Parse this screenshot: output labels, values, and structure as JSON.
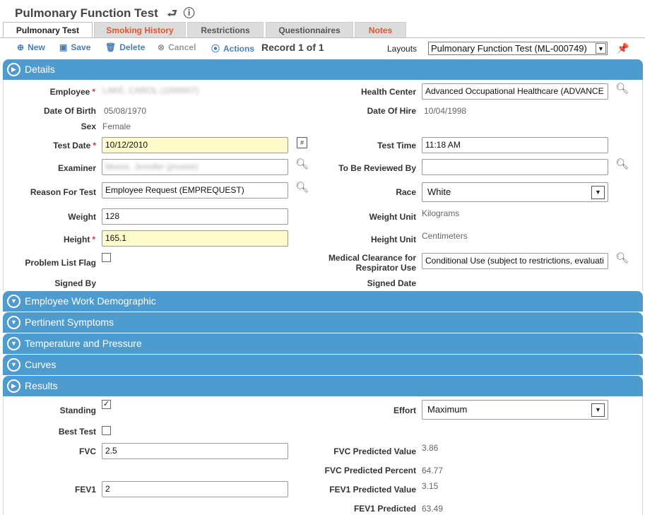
{
  "title": "Pulmonary Function Test",
  "title_icons": [
    "undo-icon",
    "info-icon"
  ],
  "tabs": [
    {
      "label": "Pulmonary Test",
      "active": true
    },
    {
      "label": "Smoking History",
      "color": "#e0572d"
    },
    {
      "label": "Restrictions"
    },
    {
      "label": "Questionnaires"
    },
    {
      "label": "Notes",
      "color": "#e0572d"
    }
  ],
  "toolbar": {
    "new": "New",
    "save": "Save",
    "delete": "Delete",
    "cancel": "Cancel",
    "actions": "Actions",
    "record": "Record 1 of 1",
    "layouts_label": "Layouts",
    "layout_value": "Pulmonary Function Test (ML-000749)"
  },
  "sections": {
    "details": "Details",
    "work_demographic": "Employee Work Demographic",
    "symptoms": "Pertinent Symptoms",
    "temperature": "Temperature and Pressure",
    "curves": "Curves",
    "results": "Results"
  },
  "details": {
    "employee_label": "Employee",
    "employee_value": "LAKE, CAROL (1000007)",
    "dob_label": "Date Of Birth",
    "dob_value": "05/08/1970",
    "sex_label": "Sex",
    "sex_value": "Female",
    "test_date_label": "Test Date",
    "test_date_value": "10/12/2010",
    "examiner_label": "Examiner",
    "examiner_value": "Moore, Jennifer (jmoore)",
    "reason_label": "Reason For Test",
    "reason_value": "Employee Request (EMPREQUEST)",
    "weight_label": "Weight",
    "weight_value": "128",
    "height_label": "Height",
    "height_value": "165.1",
    "problem_label": "Problem List Flag",
    "signed_by_label": "Signed By",
    "health_center_label": "Health Center",
    "health_center_value": "Advanced Occupational Healthcare (ADVANCE",
    "doh_label": "Date Of Hire",
    "doh_value": "10/04/1998",
    "test_time_label": "Test Time",
    "test_time_value": "11:18 AM",
    "reviewed_label": "To Be Reviewed By",
    "reviewed_value": "",
    "race_label": "Race",
    "race_value": "White",
    "weight_unit_label": "Weight Unit",
    "weight_unit_value": "Kilograms",
    "height_unit_label": "Height Unit",
    "height_unit_value": "Centimeters",
    "clearance_label_1": "Medical Clearance for",
    "clearance_label_2": "Respirator Use",
    "clearance_value": "Conditional Use (subject to restrictions, evaluati",
    "signed_date_label": "Signed Date"
  },
  "results": {
    "standing_label": "Standing",
    "standing_checked": true,
    "best_test_label": "Best Test",
    "best_test_checked": false,
    "fvc_label": "FVC",
    "fvc_value": "2.5",
    "fev1_label": "FEV1",
    "fev1_value": "2",
    "effort_label": "Effort",
    "effort_value": "Maximum",
    "fvc_pred_label": "FVC Predicted Value",
    "fvc_pred_value": "3.86",
    "fvc_pct_label": "FVC Predicted Percent",
    "fvc_pct_value": "64.77",
    "fev1_pred_label": "FEV1 Predicted Value",
    "fev1_pred_value": "3.15",
    "fev1_pct_label": "FEV1 Predicted",
    "fev1_pct_value": "63.49"
  },
  "colors": {
    "accent": "#4e9bcf",
    "link": "#4a7fb5",
    "required": "#dd3333",
    "highlight": "#fffccc",
    "tab_red": "#e0572d"
  }
}
